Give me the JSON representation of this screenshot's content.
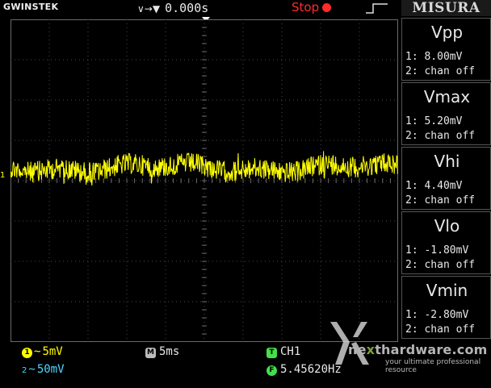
{
  "header": {
    "brand": "GWINSTEK",
    "trigger_position": "0.000s",
    "run_state": "Stop",
    "panel_title": "MISURA"
  },
  "channel_marker": "1",
  "measurements": [
    {
      "name": "Vpp",
      "ch1": "1: 8.00mV",
      "ch2": "2: chan off"
    },
    {
      "name": "Vmax",
      "ch1": "1: 5.20mV",
      "ch2": "2: chan off"
    },
    {
      "name": "Vhi",
      "ch1": "1: 4.40mV",
      "ch2": "2: chan off"
    },
    {
      "name": "Vlo",
      "ch1": "1: -1.80mV",
      "ch2": "2: chan off"
    },
    {
      "name": "Vmin",
      "ch1": "1: -2.80mV",
      "ch2": "2: chan off"
    }
  ],
  "status": {
    "ch1_badge": "1",
    "ch1_scale": "5mV",
    "ch2_badge": "2",
    "ch2_scale": "50mV",
    "timebase_badge": "M",
    "timebase": "5ms",
    "trigger_badge": "T",
    "trigger_source": "CH1",
    "freq_badge": "F",
    "frequency": "5.45620Hz"
  },
  "watermark": {
    "name_a": "ne",
    "name_b": "x",
    "name_c": "thardware",
    "name_d": ".com",
    "tagline": "your ultimate professional resource"
  },
  "colors": {
    "ch1": "#ffff00",
    "ch2": "#4fd7ff",
    "stop": "#ff2b2b",
    "trigger": "#44e04a",
    "grid": "#5a5a5a"
  },
  "icons": [
    "rising-edge-icon",
    "stop-dot-icon",
    "trigger-arrow-icon"
  ]
}
